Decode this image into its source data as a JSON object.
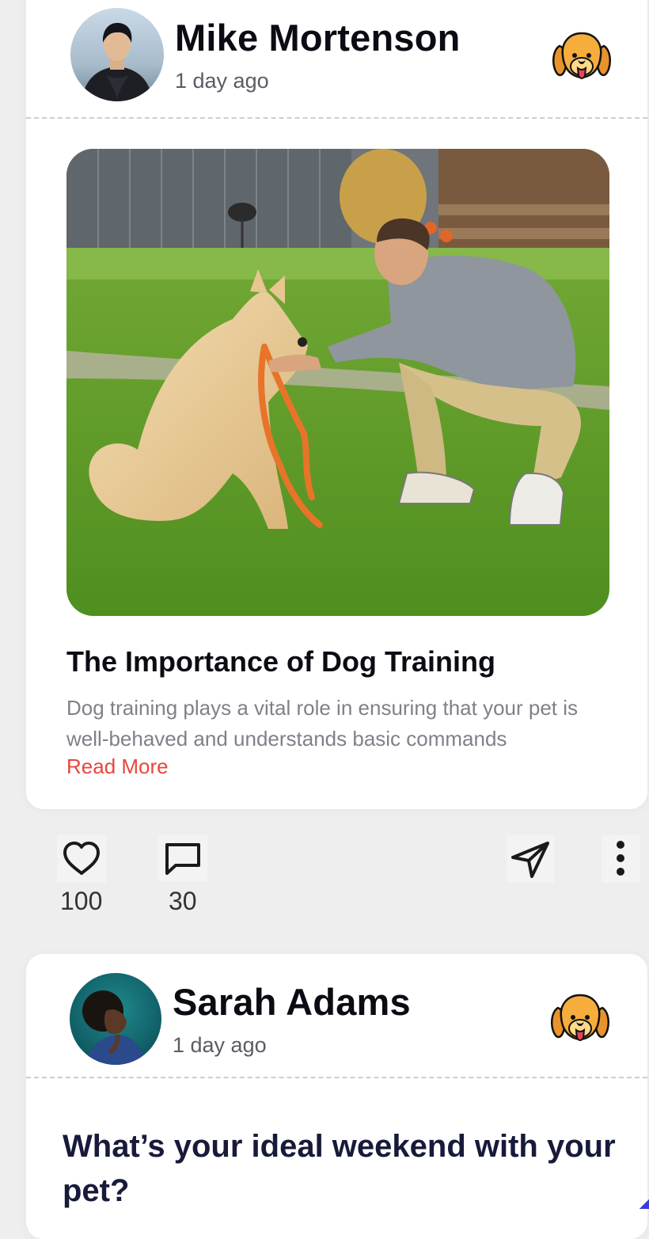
{
  "posts": [
    {
      "author": "Mike Mortenson",
      "time": "1 day ago",
      "title": "The Importance of Dog Training",
      "excerpt": "Dog training plays a vital role in ensuring that your pet is well-behaved and understands basic commands",
      "read_more": "Read More",
      "likes": "100",
      "comments": "30"
    },
    {
      "author": "Sarah Adams",
      "time": "1 day ago",
      "question": "What’s your ideal weekend with your pet?"
    }
  ],
  "icons": {
    "badge": "dog-face-icon",
    "like": "heart-icon",
    "comment": "comment-icon",
    "share": "send-icon",
    "more": "more-vertical-icon"
  },
  "colors": {
    "accent": "#e8453d",
    "question_text": "#171a3a"
  }
}
